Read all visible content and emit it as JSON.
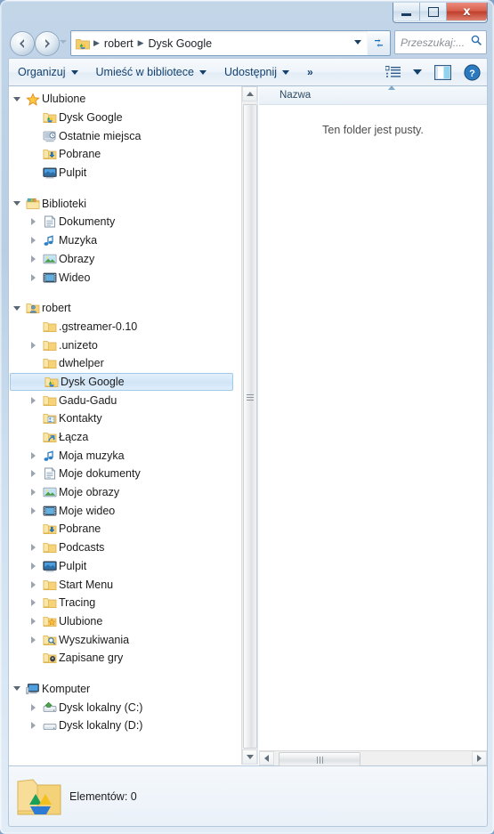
{
  "window": {
    "controls": {
      "minimize": "minimize-button",
      "maximize": "maximize-button",
      "close_label": "x"
    }
  },
  "address_bar": {
    "back": "back-button",
    "forward": "forward-button",
    "crumbs": [
      {
        "label": "robert"
      },
      {
        "label": "Dysk Google"
      }
    ],
    "separator": "▶",
    "refresh_label": "↻",
    "dropdown": "address-dropdown"
  },
  "search": {
    "placeholder": "Przeszukaj:...",
    "icon": "search-icon"
  },
  "toolbar": {
    "items": [
      {
        "label": "Organizuj",
        "caret": true
      },
      {
        "label": "Umieść w bibliotece",
        "caret": true
      },
      {
        "label": "Udostępnij",
        "caret": true
      },
      {
        "label": "»",
        "caret": false
      }
    ],
    "view_icon": "view-options-icon",
    "view_caret": "chevron-down-icon",
    "preview_icon": "preview-pane-icon",
    "help_icon": "help-icon"
  },
  "tree": {
    "groups": [
      {
        "root": {
          "label": "Ulubione",
          "icon": "star-icon",
          "expanded": true
        },
        "children": [
          {
            "label": "Dysk Google",
            "icon": "gdrive-folder-icon",
            "twisty": "none"
          },
          {
            "label": "Ostatnie miejsca",
            "icon": "recent-places-icon",
            "twisty": "none"
          },
          {
            "label": "Pobrane",
            "icon": "downloads-folder-icon",
            "twisty": "none"
          },
          {
            "label": "Pulpit",
            "icon": "desktop-icon",
            "twisty": "none"
          }
        ]
      },
      {
        "root": {
          "label": "Biblioteki",
          "icon": "libraries-icon",
          "expanded": true
        },
        "children": [
          {
            "label": "Dokumenty",
            "icon": "documents-library-icon",
            "twisty": "closed"
          },
          {
            "label": "Muzyka",
            "icon": "music-library-icon",
            "twisty": "closed"
          },
          {
            "label": "Obrazy",
            "icon": "pictures-library-icon",
            "twisty": "closed"
          },
          {
            "label": "Wideo",
            "icon": "videos-library-icon",
            "twisty": "closed"
          }
        ]
      },
      {
        "root": {
          "label": "robert",
          "icon": "user-folder-icon",
          "expanded": true
        },
        "children": [
          {
            "label": ".gstreamer-0.10",
            "icon": "folder-icon",
            "twisty": "none"
          },
          {
            "label": ".unizeto",
            "icon": "folder-icon",
            "twisty": "closed"
          },
          {
            "label": "dwhelper",
            "icon": "folder-icon",
            "twisty": "none"
          },
          {
            "label": "Dysk Google",
            "icon": "gdrive-folder-icon",
            "twisty": "none",
            "selected": true
          },
          {
            "label": "Gadu-Gadu",
            "icon": "folder-icon",
            "twisty": "closed"
          },
          {
            "label": "Kontakty",
            "icon": "contacts-folder-icon",
            "twisty": "none"
          },
          {
            "label": "Łącza",
            "icon": "links-folder-icon",
            "twisty": "none"
          },
          {
            "label": "Moja muzyka",
            "icon": "music-folder-icon",
            "twisty": "closed"
          },
          {
            "label": "Moje dokumenty",
            "icon": "documents-folder-icon",
            "twisty": "closed"
          },
          {
            "label": "Moje obrazy",
            "icon": "pictures-folder-icon",
            "twisty": "closed"
          },
          {
            "label": "Moje wideo",
            "icon": "videos-folder-icon",
            "twisty": "closed"
          },
          {
            "label": "Pobrane",
            "icon": "downloads-folder-icon",
            "twisty": "none"
          },
          {
            "label": "Podcasts",
            "icon": "folder-icon",
            "twisty": "closed"
          },
          {
            "label": "Pulpit",
            "icon": "desktop-folder-icon",
            "twisty": "closed"
          },
          {
            "label": "Start Menu",
            "icon": "folder-icon",
            "twisty": "closed"
          },
          {
            "label": "Tracing",
            "icon": "folder-icon",
            "twisty": "closed"
          },
          {
            "label": "Ulubione",
            "icon": "favorites-folder-icon",
            "twisty": "closed"
          },
          {
            "label": "Wyszukiwania",
            "icon": "searches-folder-icon",
            "twisty": "closed"
          },
          {
            "label": "Zapisane gry",
            "icon": "saved-games-folder-icon",
            "twisty": "none"
          }
        ]
      },
      {
        "root": {
          "label": "Komputer",
          "icon": "computer-icon",
          "expanded": true
        },
        "children": [
          {
            "label": "Dysk lokalny (C:)",
            "icon": "system-drive-icon",
            "twisty": "closed"
          },
          {
            "label": "Dysk lokalny (D:)",
            "icon": "drive-icon",
            "twisty": "closed"
          }
        ]
      }
    ]
  },
  "content": {
    "column_header": "Nazwa",
    "empty_message": "Ten folder jest pusty."
  },
  "status": {
    "text": "Elementów: 0",
    "icon": "gdrive-folder-large-icon"
  }
}
